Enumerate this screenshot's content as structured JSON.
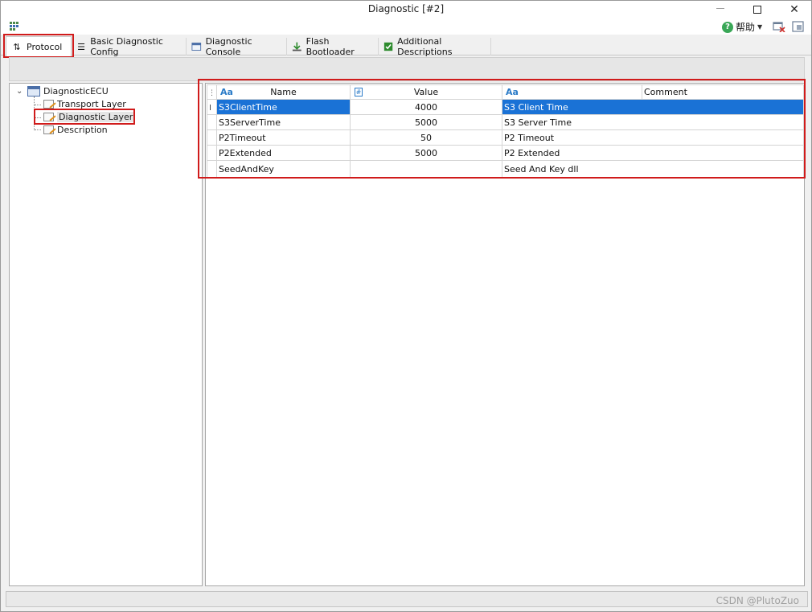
{
  "window": {
    "title": "Diagnostic [#2]",
    "help_label": "帮助",
    "help_icon": "help-icon"
  },
  "tabs": [
    {
      "label": "Protocol",
      "icon": "sort-arrows-icon",
      "active": true
    },
    {
      "label": "Basic Diagnostic Config",
      "icon": "list-icon",
      "active": false
    },
    {
      "label": "Diagnostic Console",
      "icon": "console-window-icon",
      "active": false
    },
    {
      "label": "Flash Bootloader",
      "icon": "download-icon",
      "active": false
    },
    {
      "label": "Additional Descriptions",
      "icon": "checkbox-icon",
      "active": false
    }
  ],
  "tree": {
    "root": "DiagnosticECU",
    "children": [
      "Transport Layer",
      "Diagnostic Layer",
      "Description"
    ],
    "selected": "Diagnostic Layer"
  },
  "table": {
    "columns": {
      "name": "Name",
      "value": "Value",
      "comment": "Comment"
    },
    "header_type_name": "Aa",
    "header_type_value": "#",
    "header_type_comment": "Aa",
    "rows": [
      {
        "name": "S3ClientTime",
        "value": "4000",
        "comment": "S3 Client Time",
        "selected": true
      },
      {
        "name": "S3ServerTime",
        "value": "5000",
        "comment": "S3 Server Time"
      },
      {
        "name": "P2Timeout",
        "value": "50",
        "comment": "P2 Timeout"
      },
      {
        "name": "P2Extended",
        "value": "5000",
        "comment": "P2 Extended"
      },
      {
        "name": "SeedAndKey",
        "value": "",
        "comment": "Seed And Key dll"
      }
    ]
  },
  "status": {
    "watermark": "CSDN @PlutoZuo"
  },
  "colors": {
    "selection": "#1a72d6",
    "annotation": "#d01b1b",
    "accent": "#2c7cc8"
  }
}
